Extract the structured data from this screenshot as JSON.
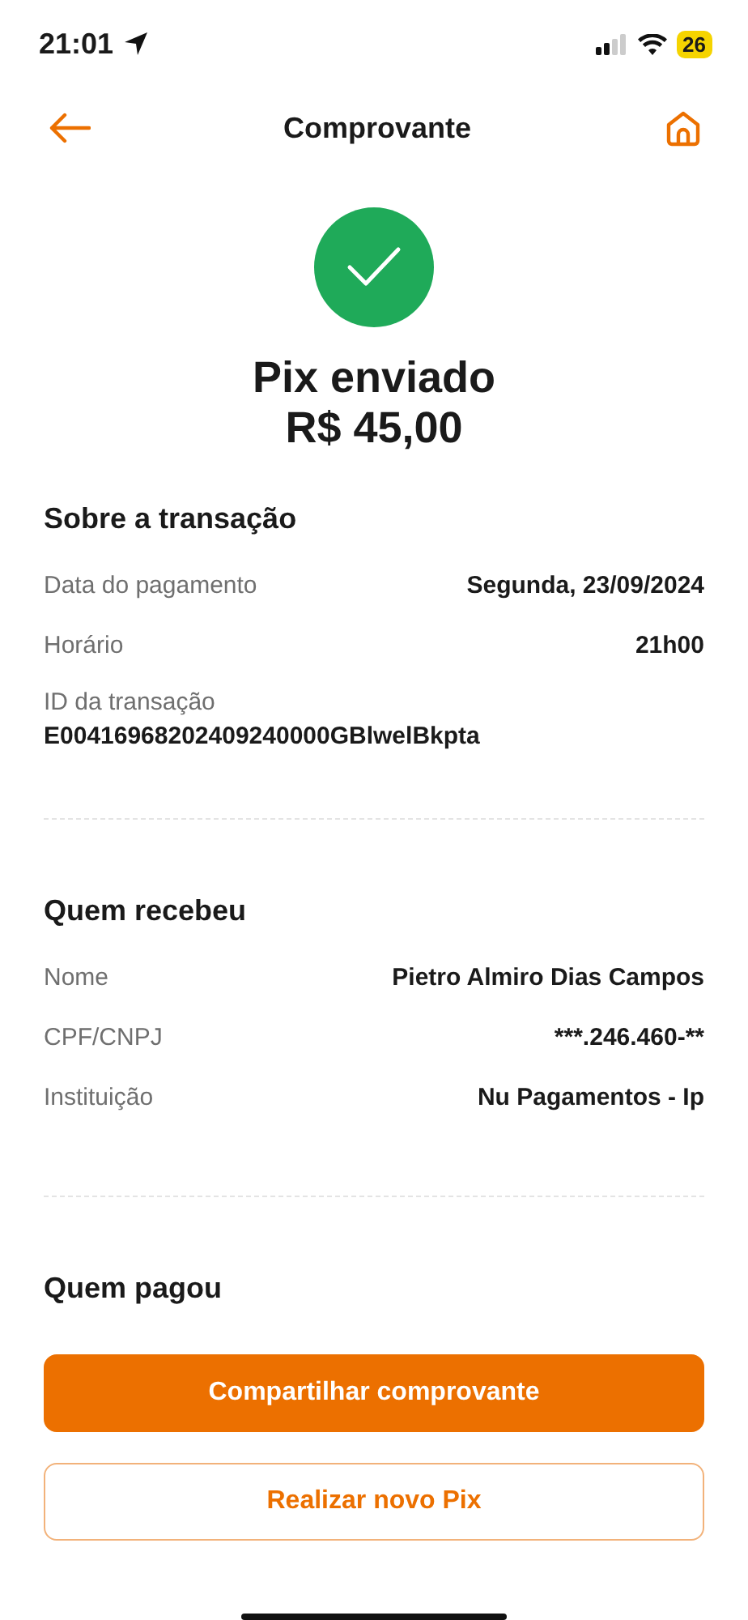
{
  "status_bar": {
    "time": "21:01",
    "battery": "26"
  },
  "header": {
    "title": "Comprovante"
  },
  "result": {
    "title": "Pix enviado",
    "amount": "R$ 45,00"
  },
  "sections": [
    {
      "title": "Sobre a transação",
      "rows": [
        {
          "kind": "pair",
          "label": "Data do pagamento",
          "value": "Segunda, 23/09/2024"
        },
        {
          "kind": "pair",
          "label": "Horário",
          "value": "21h00"
        },
        {
          "kind": "stacked",
          "label": "ID da transação",
          "value": "E00416968202409240000GBlwelBkpta"
        }
      ]
    },
    {
      "title": "Quem recebeu",
      "rows": [
        {
          "kind": "pair",
          "label": "Nome",
          "value": "Pietro Almiro Dias Campos"
        },
        {
          "kind": "pair",
          "label": "CPF/CNPJ",
          "value": "***.246.460-**"
        },
        {
          "kind": "pair",
          "label": "Instituição",
          "value": "Nu Pagamentos - Ip"
        }
      ]
    },
    {
      "title": "Quem pagou"
    }
  ],
  "buttons": [
    {
      "kind": "primary",
      "label": "Compartilhar comprovante"
    },
    {
      "kind": "secondary",
      "label": "Realizar novo Pix"
    }
  ]
}
